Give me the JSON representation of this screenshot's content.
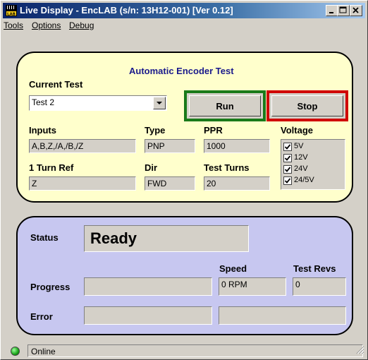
{
  "window": {
    "title": "Live Display - EncLAB (s/n: 13H12-001) [Ver 0.12]",
    "app_icon": "lab-icon"
  },
  "menu": [
    {
      "label": "Tools"
    },
    {
      "label": "Options"
    },
    {
      "label": "Debug"
    }
  ],
  "test_panel": {
    "heading": "Automatic Encoder Test",
    "current_test_label": "Current Test",
    "current_test_value": "Test 2",
    "run_label": "Run",
    "stop_label": "Stop",
    "inputs_label": "Inputs",
    "inputs_value": "A,B,Z,/A,/B,/Z",
    "type_label": "Type",
    "type_value": "PNP",
    "ppr_label": "PPR",
    "ppr_value": "1000",
    "voltage_label": "Voltage",
    "voltages": [
      {
        "label": "5V",
        "checked": true
      },
      {
        "label": "12V",
        "checked": true
      },
      {
        "label": "24V",
        "checked": true
      },
      {
        "label": "24/5V",
        "checked": true
      }
    ],
    "turn_ref_label": "1 Turn Ref",
    "turn_ref_value": "Z",
    "dir_label": "Dir",
    "dir_value": "FWD",
    "test_turns_label": "Test Turns",
    "test_turns_value": "20"
  },
  "status_panel": {
    "status_label": "Status",
    "status_value": "Ready",
    "speed_label": "Speed",
    "speed_value": "0 RPM",
    "test_revs_label": "Test Revs",
    "test_revs_value": "0",
    "progress_label": "Progress",
    "progress_value": "",
    "error_label": "Error",
    "error_value": "",
    "error_detail_value": ""
  },
  "statusbar": {
    "text": "Online",
    "led_color": "#1aa31a"
  },
  "colors": {
    "title_bar": "#0a246a",
    "top_panel": "#ffffcc",
    "bottom_panel": "#c7c7f0",
    "run_border": "#1a7a1a",
    "stop_border": "#d00000"
  }
}
